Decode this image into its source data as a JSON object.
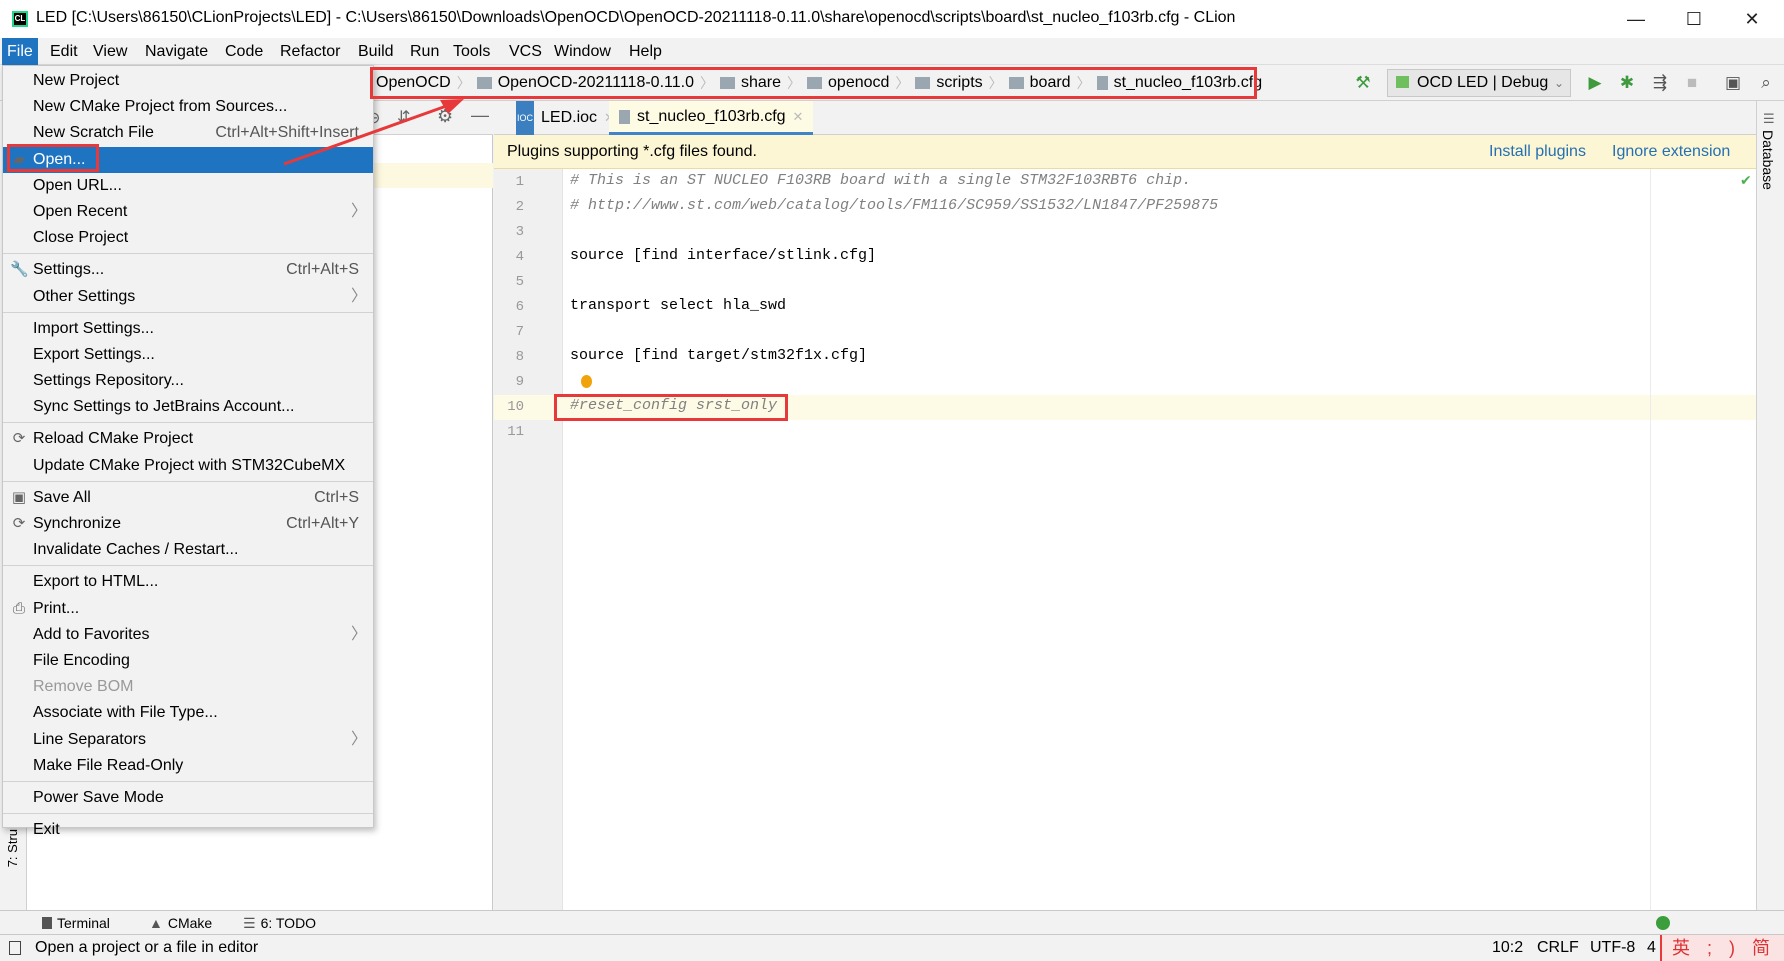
{
  "window": {
    "title": "LED [C:\\Users\\86150\\CLionProjects\\LED] - C:\\Users\\86150\\Downloads\\OpenOCD\\OpenOCD-20211118-0.11.0\\share\\openocd\\scripts\\board\\st_nucleo_f103rb.cfg - CLion",
    "logo": "CL",
    "minimize": "—",
    "maximize": "☐",
    "close": "✕"
  },
  "menubar": [
    "File",
    "Edit",
    "View",
    "Navigate",
    "Code",
    "Refactor",
    "Build",
    "Run",
    "Tools",
    "VCS",
    "Window",
    "Help"
  ],
  "breadcrumb": [
    "OpenOCD",
    "OpenOCD-20211118-0.11.0",
    "share",
    "openocd",
    "scripts",
    "board",
    "st_nucleo_f103rb.cfg"
  ],
  "run_config": "OCD LED | Debug",
  "tabs": [
    {
      "label": "LED.ioc",
      "selected": false
    },
    {
      "label": "st_nucleo_f103rb.cfg",
      "selected": true
    }
  ],
  "notification": {
    "text": "Plugins supporting *.cfg files found.",
    "install": "Install plugins",
    "ignore": "Ignore extension"
  },
  "editor": {
    "lines": [
      {
        "n": "1",
        "text": "# This is an ST NUCLEO F103RB board with a single STM32F103RBT6 chip.",
        "comment": true
      },
      {
        "n": "2",
        "text": "# http://www.st.com/web/catalog/tools/FM116/SC959/SS1532/LN1847/PF259875",
        "comment": true
      },
      {
        "n": "3",
        "text": "",
        "comment": false
      },
      {
        "n": "4",
        "text": "source [find interface/stlink.cfg]",
        "comment": false
      },
      {
        "n": "5",
        "text": "",
        "comment": false
      },
      {
        "n": "6",
        "text": "transport select hla_swd",
        "comment": false
      },
      {
        "n": "7",
        "text": "",
        "comment": false
      },
      {
        "n": "8",
        "text": "source [find target/stm32f1x.cfg]",
        "comment": false
      },
      {
        "n": "9",
        "text": "",
        "comment": false
      },
      {
        "n": "10",
        "text": "#reset_config srst_only",
        "comment": true
      },
      {
        "n": "11",
        "text": "",
        "comment": false
      }
    ],
    "current_line": 10
  },
  "file_menu": {
    "groups": [
      [
        {
          "label": "New Project"
        },
        {
          "label": "New CMake Project from Sources..."
        },
        {
          "label": "New Scratch File",
          "shortcut": "Ctrl+Alt+Shift+Insert"
        },
        {
          "label": "Open...",
          "icon": "folder-icon",
          "highlighted": true
        },
        {
          "label": "Open URL..."
        },
        {
          "label": "Open Recent",
          "submenu": true
        },
        {
          "label": "Close Project"
        }
      ],
      [
        {
          "label": "Settings...",
          "shortcut": "Ctrl+Alt+S",
          "icon": "wrench-icon"
        },
        {
          "label": "Other Settings",
          "submenu": true
        }
      ],
      [
        {
          "label": "Import Settings..."
        },
        {
          "label": "Export Settings..."
        },
        {
          "label": "Settings Repository..."
        },
        {
          "label": "Sync Settings to JetBrains Account..."
        }
      ],
      [
        {
          "label": "Reload CMake Project",
          "icon": "reload-icon"
        },
        {
          "label": "Update CMake Project with STM32CubeMX"
        }
      ],
      [
        {
          "label": "Save All",
          "shortcut": "Ctrl+S",
          "icon": "save-icon"
        },
        {
          "label": "Synchronize",
          "shortcut": "Ctrl+Alt+Y",
          "icon": "sync-icon"
        },
        {
          "label": "Invalidate Caches / Restart..."
        }
      ],
      [
        {
          "label": "Export to HTML..."
        },
        {
          "label": "Print...",
          "icon": "print-icon"
        },
        {
          "label": "Add to Favorites",
          "submenu": true
        },
        {
          "label": "File Encoding"
        },
        {
          "label": "Remove BOM",
          "disabled": true
        },
        {
          "label": "Associate with File Type..."
        },
        {
          "label": "Line Separators",
          "submenu": true
        },
        {
          "label": "Make File Read-Only"
        }
      ],
      [
        {
          "label": "Power Save Mode"
        }
      ],
      [
        {
          "label": "Exit"
        }
      ]
    ]
  },
  "left_strip_label": "7: Stru",
  "right_strip_label": "Database",
  "bottom_tools": [
    "Terminal",
    "CMake",
    "6: TODO"
  ],
  "status": {
    "message": "Open a project or a file in editor",
    "position": "10:2",
    "line_sep": "CRLF",
    "encoding": "UTF-8",
    "indent": "4"
  },
  "ime": "英 ; ) 简",
  "colors": {
    "accent": "#1f74c1",
    "annotation": "#e8393a",
    "link": "#2470b3"
  }
}
